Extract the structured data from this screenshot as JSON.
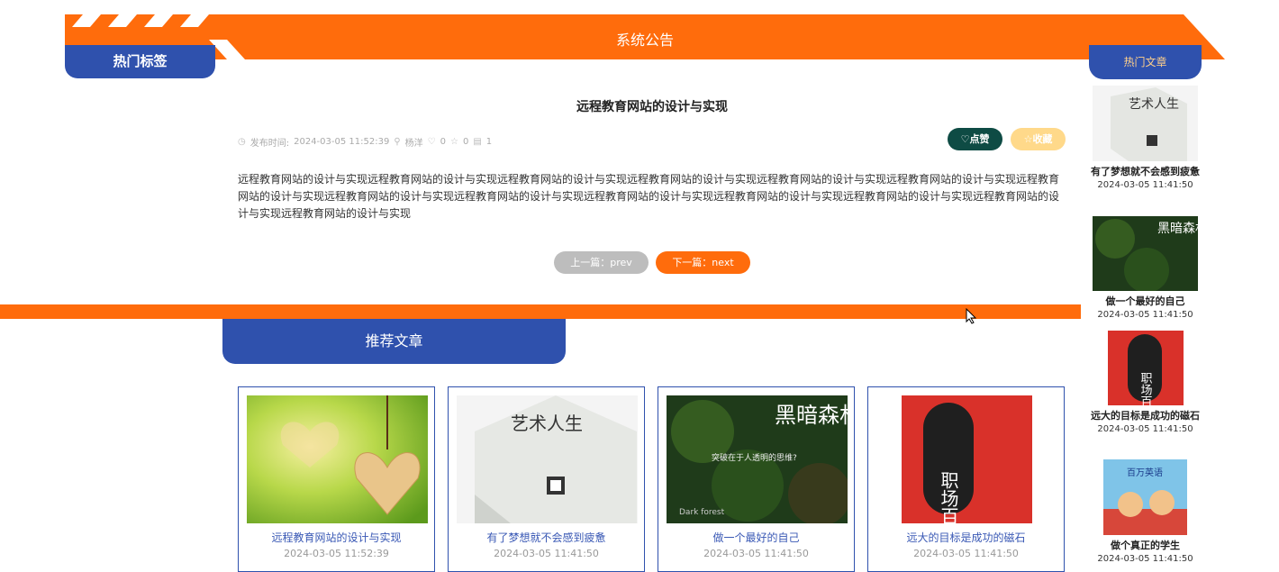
{
  "banner": {
    "title": "系统公告"
  },
  "left_tab": {
    "label": "热门标签"
  },
  "right_tab": {
    "label": "热门文章"
  },
  "article": {
    "title": "远程教育网站的设计与实现",
    "meta": {
      "publish_label": "发布时间:",
      "publish_time": "2024-03-05 11:52:39",
      "author": "杨洋",
      "likes": "0",
      "favorites": "0",
      "comments": "1"
    },
    "like_label": "点赞",
    "fav_label": "收藏",
    "content": "远程教育网站的设计与实现远程教育网站的设计与实现远程教育网站的设计与实现远程教育网站的设计与实现远程教育网站的设计与实现远程教育网站的设计与实现远程教育网站的设计与实现远程教育网站的设计与实现远程教育网站的设计与实现远程教育网站的设计与实现远程教育网站的设计与实现远程教育网站的设计与实现远程教育网站的设计与实现远程教育网站的设计与实现",
    "prev_label": "上一篇：prev",
    "next_label": "下一篇：next"
  },
  "recommend": {
    "label": "推荐文章",
    "cards": [
      {
        "title": "远程教育网站的设计与实现",
        "date": "2024-03-05 11:52:39"
      },
      {
        "title": "有了梦想就不会感到疲惫",
        "date": "2024-03-05 11:41:50"
      },
      {
        "title": "做一个最好的自己",
        "date": "2024-03-05 11:41:50"
      },
      {
        "title": "远大的目标是成功的磁石",
        "date": "2024-03-05 11:41:50"
      }
    ]
  },
  "sidebar": {
    "items": [
      {
        "title": "有了梦想就不会感到疲惫",
        "date": "2024-03-05 11:41:50"
      },
      {
        "title": "做一个最好的自己",
        "date": "2024-03-05 11:41:50"
      },
      {
        "title": "远大的目标是成功的磁石",
        "date": "2024-03-05 11:41:50"
      },
      {
        "title": "做个真正的学生",
        "date": "2024-03-05 11:41:50"
      }
    ]
  },
  "book_covers": {
    "art": "艺术人生",
    "forest_title": "黑暗森林",
    "forest_subtitle": "突破在于人透明的思维?",
    "forest_corner": "Dark forest",
    "career": "职场百度",
    "student": "百万英语"
  },
  "colors": {
    "orange": "#ff6c0c",
    "blue": "#2f51ad",
    "dark_green": "#0e4b44",
    "light_gold": "#ffd98a"
  }
}
